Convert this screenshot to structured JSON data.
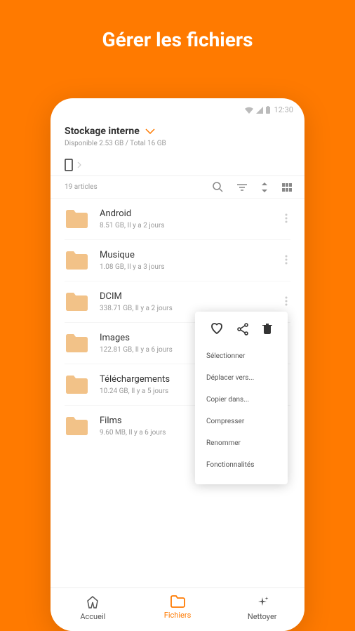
{
  "header_title": "Gérer les fichiers",
  "status_bar": {
    "time": "12:30"
  },
  "storage": {
    "title": "Stockage interne",
    "subtitle": "Disponible 2.53 GB / Total 16 GB"
  },
  "toolbar": {
    "count": "19 articles"
  },
  "files": [
    {
      "name": "Android",
      "meta": "8.51 GB, Il y a 2 jours"
    },
    {
      "name": "Musique",
      "meta": "1.08 GB, Il y a 3 jours"
    },
    {
      "name": "DCIM",
      "meta": "338.71 GB, Il y a 2 jours"
    },
    {
      "name": "Images",
      "meta": "122.81 GB, Il y a 6 jours"
    },
    {
      "name": "Téléchargements",
      "meta": "10.24 GB, Il y a 5 jours"
    },
    {
      "name": "Films",
      "meta": "9.60 MB, Il y a 6 jours"
    }
  ],
  "context_menu": {
    "select": "Sélectionner",
    "move": "Déplacer vers...",
    "copy": "Copier dans...",
    "compress": "Compresser",
    "rename": "Renommer",
    "features": "Fonctionnalités"
  },
  "nav": {
    "home": "Accueil",
    "files": "Fichiers",
    "clean": "Nettoyer"
  },
  "colors": {
    "accent": "#ff7a00",
    "folder": "#f2c288"
  }
}
